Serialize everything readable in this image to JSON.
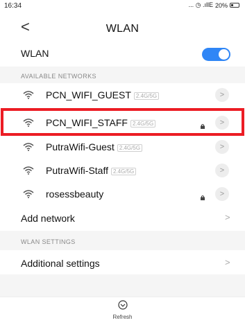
{
  "status_bar": {
    "time": "16:34",
    "signal": "... ◷ .ıllE",
    "battery": "20%"
  },
  "header": {
    "back": "<",
    "title": "WLAN"
  },
  "wlan_toggle": {
    "label": "WLAN",
    "on": true,
    "accent": "#2f86f6"
  },
  "available": {
    "section_label": "AVAILABLE NETWORKS",
    "networks": [
      {
        "name": "PCN_WIFI_GUEST",
        "band": "2.4G/5G",
        "locked": false
      },
      {
        "name": "PCN_WIFI_STAFF",
        "band": "2.4G/5G",
        "locked": true
      },
      {
        "name": "PutraWifi-Guest",
        "band": "2.4G/5G",
        "locked": false
      },
      {
        "name": "PutraWifi-Staff",
        "band": "2.4G/5G",
        "locked": false
      },
      {
        "name": "rosessbeauty",
        "band": "",
        "locked": true
      }
    ]
  },
  "add_network": {
    "label": "Add network"
  },
  "settings": {
    "section_label": "WLAN SETTINGS",
    "additional_label": "Additional settings"
  },
  "bottom": {
    "refresh_label": "Refresh"
  },
  "highlight_color": "#ec1c24"
}
